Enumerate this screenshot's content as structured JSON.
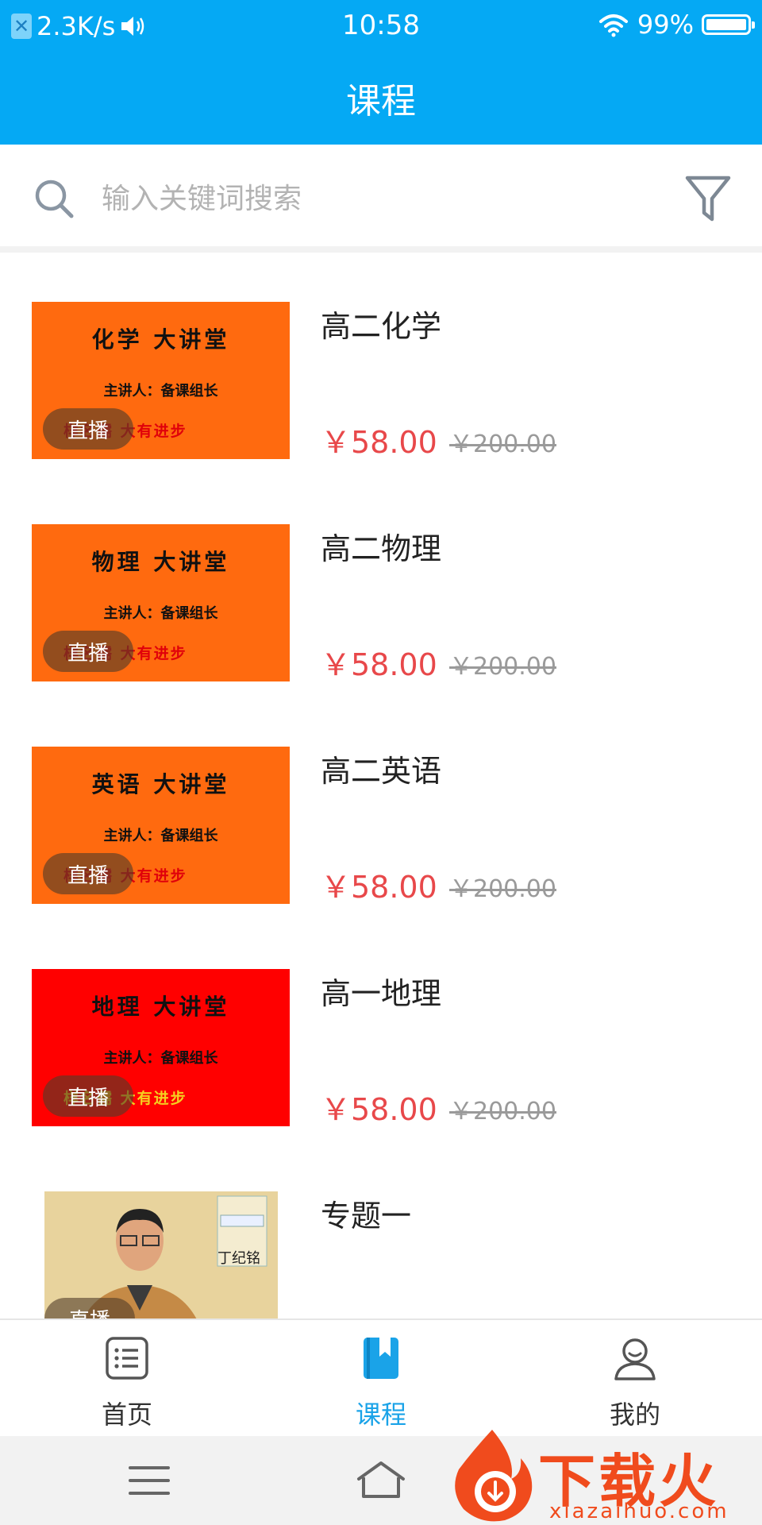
{
  "status_bar": {
    "speed": "2.3K/s",
    "time": "10:58",
    "battery": "99%",
    "battery_level": 0.99
  },
  "header": {
    "title": "课程"
  },
  "search": {
    "placeholder": "输入关键词搜索"
  },
  "courses": [
    {
      "title": "高二化学",
      "price": "￥58.00",
      "original_price": "￥200.00",
      "badge": "直播",
      "thumb_title": "化学 大讲堂",
      "thumb_line2": "主讲人：备课组长",
      "thumb_line3": "样名儒 大有进步",
      "thumb_color": "#ff6a0f"
    },
    {
      "title": "高二物理",
      "price": "￥58.00",
      "original_price": "￥200.00",
      "badge": "直播",
      "thumb_title": "物理 大讲堂",
      "thumb_line2": "主讲人：备课组长",
      "thumb_line3": "样名儒 大有进步",
      "thumb_color": "#ff6a0f"
    },
    {
      "title": "高二英语",
      "price": "￥58.00",
      "original_price": "￥200.00",
      "badge": "直播",
      "thumb_title": "英语 大讲堂",
      "thumb_line2": "主讲人：备课组长",
      "thumb_line3": "样名儒 大有进步",
      "thumb_color": "#ff6a0f"
    },
    {
      "title": "高一地理",
      "price": "￥58.00",
      "original_price": "￥200.00",
      "badge": "直播",
      "thumb_title": "地理 大讲堂",
      "thumb_line2": "主讲人：备课组长",
      "thumb_line3": "样名儒 大有进步",
      "thumb_color": "#ff0000"
    },
    {
      "title": "专题一",
      "badge": "直播",
      "photo_caption": "丁纪铭"
    }
  ],
  "tabs": [
    {
      "label": "首页",
      "icon": "list-icon",
      "active": false
    },
    {
      "label": "课程",
      "icon": "bookmark-book-icon",
      "active": true
    },
    {
      "label": "我的",
      "icon": "user-icon",
      "active": false
    }
  ],
  "watermark": {
    "logo": "下载火",
    "site": "xiazaihuo.com"
  },
  "colors": {
    "accent": "#05a9f4",
    "price": "#e8484a",
    "tab_active": "#1aa3e8"
  }
}
